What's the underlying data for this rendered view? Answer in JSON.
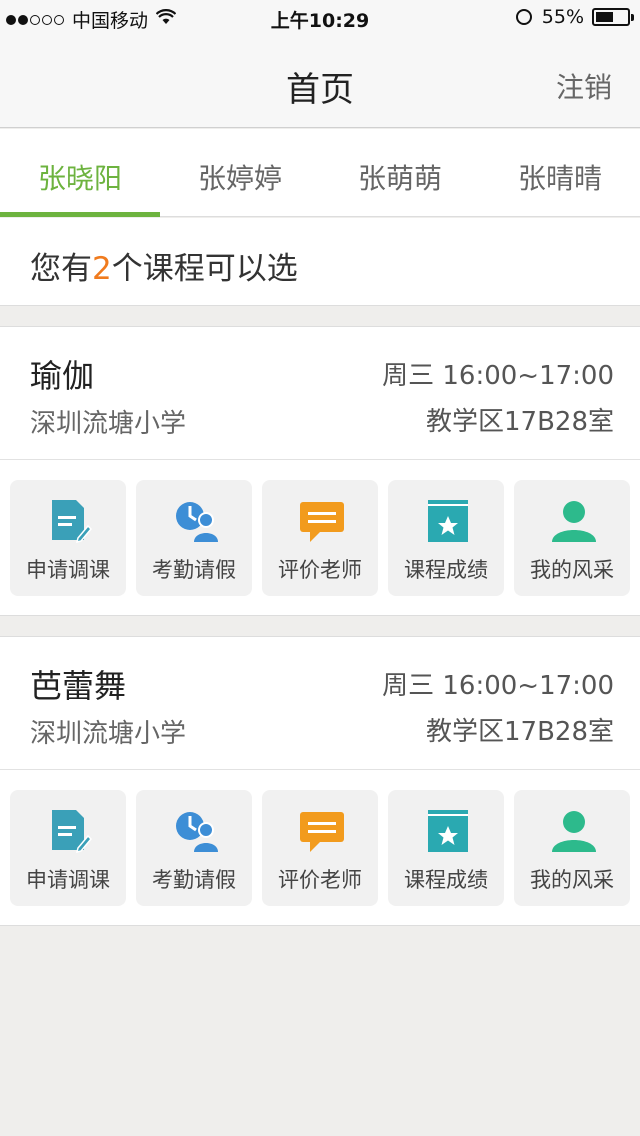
{
  "status_bar": {
    "carrier": "中国移动",
    "time": "上午10:29",
    "battery_percent": "55%",
    "battery_level": 0.55,
    "signal_bars": 2
  },
  "nav": {
    "title": "首页",
    "logout_label": "注销"
  },
  "tabs": [
    {
      "label": "张晓阳",
      "active": true
    },
    {
      "label": "张婷婷",
      "active": false
    },
    {
      "label": "张萌萌",
      "active": false
    },
    {
      "label": "张晴晴",
      "active": false
    }
  ],
  "summary": {
    "prefix": "您有",
    "count": "2",
    "suffix": "个课程可以选"
  },
  "courses": [
    {
      "name": "瑜伽",
      "time": "周三 16:00~17:00",
      "school": "深圳流塘小学",
      "room": "教学区17B28室"
    },
    {
      "name": "芭蕾舞",
      "time": "周三 16:00~17:00",
      "school": "深圳流塘小学",
      "room": "教学区17B28室"
    }
  ],
  "actions": [
    {
      "label": "申请调课",
      "icon": "document-edit-icon",
      "color": "#3aa0b8"
    },
    {
      "label": "考勤请假",
      "icon": "clock-person-icon",
      "color": "#3d8ed6"
    },
    {
      "label": "评价老师",
      "icon": "comment-icon",
      "color": "#f29b1d"
    },
    {
      "label": "课程成绩",
      "icon": "star-book-icon",
      "color": "#2aa9b1"
    },
    {
      "label": "我的风采",
      "icon": "person-icon",
      "color": "#2dba8c"
    }
  ],
  "colors": {
    "accent": "#6db33f",
    "highlight": "#f07b1e"
  }
}
